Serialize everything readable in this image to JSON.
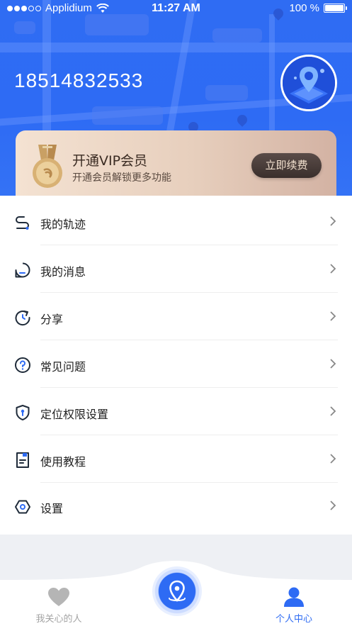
{
  "status_bar": {
    "carrier": "Applidium",
    "time": "11:27 AM",
    "battery": "100 %"
  },
  "profile": {
    "phone": "18514832533",
    "avatar_icon": "map-pin-avatar-icon"
  },
  "vip": {
    "title": "开通VIP会员",
    "subtitle": "开通会员解锁更多功能",
    "button": "立即续费",
    "medal_icon": "medal-icon"
  },
  "menu": {
    "items": [
      {
        "label": "我的轨迹",
        "icon": "track-icon"
      },
      {
        "label": "我的消息",
        "icon": "message-icon"
      },
      {
        "label": "分享",
        "icon": "share-icon"
      },
      {
        "label": "常见问题",
        "icon": "help-icon"
      },
      {
        "label": "定位权限设置",
        "icon": "shield-lock-icon"
      },
      {
        "label": "使用教程",
        "icon": "tutorial-icon"
      },
      {
        "label": "设置",
        "icon": "settings-icon"
      }
    ]
  },
  "tabbar": {
    "left_label": "我关心的人",
    "right_label": "个人中心"
  },
  "colors": {
    "primary": "#2e6bf4",
    "icon": "#1f2b3a",
    "accent_dot": "#2e6bf4",
    "vip_button": "#3a2f2c",
    "tab_inactive": "#a4a4a4"
  }
}
